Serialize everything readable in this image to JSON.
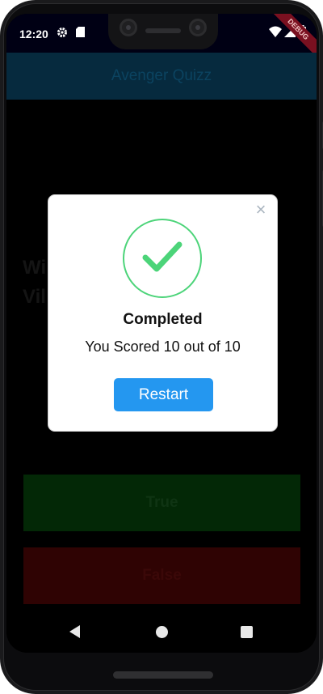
{
  "status_bar": {
    "time": "12:20",
    "icons": [
      "gear-icon",
      "sim-card-icon",
      "wifi-icon",
      "battery-icon"
    ]
  },
  "debug_banner": "DEBUG",
  "app_bar": {
    "title": "Avenger Quizz"
  },
  "question": {
    "line1": "Wi",
    "line2": "Vil"
  },
  "answers": {
    "true_label": "True",
    "false_label": "False"
  },
  "dialog": {
    "title": "Completed",
    "message": "You Scored 10 out of 10",
    "button_label": "Restart",
    "success_color": "#4cd479",
    "button_color": "#2497f0"
  },
  "colors": {
    "app_bar": "#062a3e",
    "true_button": "#032806",
    "false_button": "#2f0303"
  }
}
